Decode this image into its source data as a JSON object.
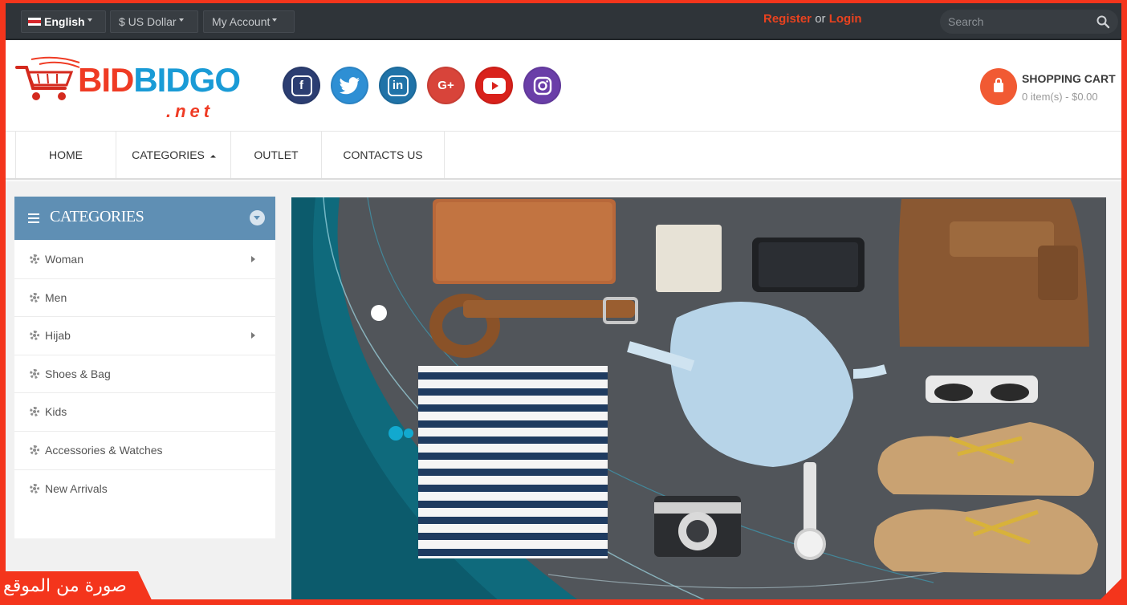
{
  "topbar": {
    "language": "English",
    "currency": "$ US Dollar",
    "account": "My Account",
    "register": "Register",
    "or": "or",
    "login": "Login",
    "search_placeholder": "Search"
  },
  "header": {
    "logo_brand_1": "BID",
    "logo_brand_2": "BID",
    "logo_brand_3": "GO",
    "logo_domain": ".net",
    "socials": [
      {
        "name": "facebook",
        "glyph": "f",
        "color": "#2c3e72"
      },
      {
        "name": "twitter",
        "glyph": "t",
        "color": "#2e8fd4"
      },
      {
        "name": "linkedin",
        "glyph": "in",
        "color": "#2073a8"
      },
      {
        "name": "google-plus",
        "glyph": "G+",
        "color": "#d8443a"
      },
      {
        "name": "youtube",
        "glyph": "▶",
        "color": "#d9211b"
      },
      {
        "name": "instagram",
        "glyph": "◎",
        "color": "#6a3ea8"
      }
    ],
    "cart_title": "SHOPPING CART",
    "cart_summary": "0 item(s) - $0.00"
  },
  "nav": {
    "home": "HOME",
    "categories": "CATEGORIES",
    "outlet": "OUTLET",
    "contact": "CONTACTS US"
  },
  "sidebar": {
    "title": "CATEGORIES",
    "items": [
      {
        "label": "Woman",
        "has_sub": true
      },
      {
        "label": "Men",
        "has_sub": false
      },
      {
        "label": "Hijab",
        "has_sub": true
      },
      {
        "label": "Shoes & Bag",
        "has_sub": false
      },
      {
        "label": "Kids",
        "has_sub": false
      },
      {
        "label": "Accessories & Watches",
        "has_sub": false
      },
      {
        "label": "New Arrivals",
        "has_sub": false
      }
    ]
  },
  "overlay_label": "صورة من الموقع",
  "colors": {
    "frame": "#f4351c",
    "topbar": "#2f3439",
    "accent": "#e8421f",
    "sidebar_header": "#5f8fb4",
    "banner_teal": "#0f6a7c",
    "banner_bg": "#55595e"
  }
}
